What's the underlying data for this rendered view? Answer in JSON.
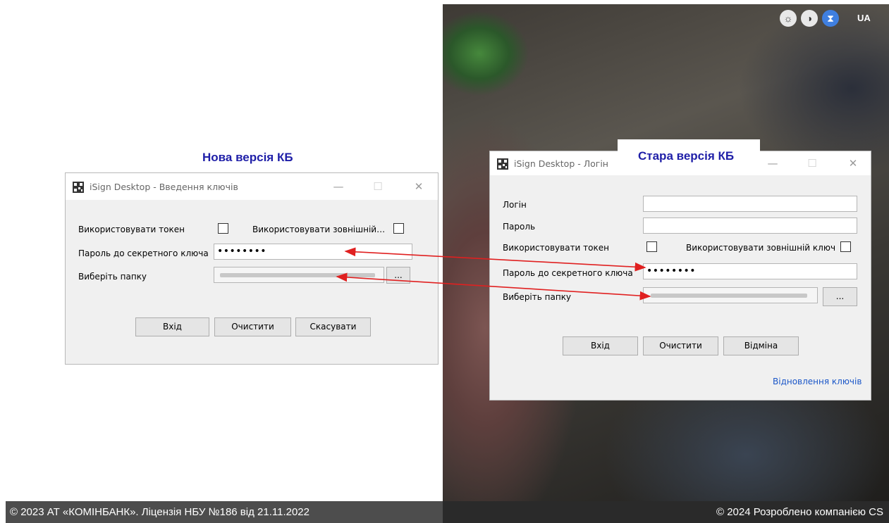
{
  "captions": {
    "new_version": "Нова версія КБ",
    "old_version": "Стара версія КБ"
  },
  "top_controls": {
    "icons": [
      "brightness-icon",
      "contrast-icon",
      "hourglass-icon"
    ],
    "language": "UA"
  },
  "new_dialog": {
    "title": "iSign Desktop - Введення ключів",
    "use_token_label": "Використовувати токен",
    "use_external_label": "Використовувати зовнішній…",
    "password_label": "Пароль до секретного ключа",
    "password_value": "••••••••",
    "folder_label": "Виберіть папку",
    "browse_label": "...",
    "buttons": {
      "login": "Вхід",
      "clear": "Очистити",
      "cancel": "Скасувати"
    }
  },
  "old_dialog": {
    "title": "iSign Desktop - Логін",
    "login_label": "Логін",
    "password_label": "Пароль",
    "use_token_label": "Використовувати токен",
    "use_external_label": "Використовувати зовнішній ключ",
    "secret_password_label": "Пароль до секретного ключа",
    "secret_password_value": "••••••••",
    "folder_label": "Виберіть папку",
    "browse_label": "...",
    "buttons": {
      "login": "Вхід",
      "clear": "Очистити",
      "cancel": "Відміна"
    },
    "restore_link": "Відновлення ключів"
  },
  "footer": {
    "left": "© 2023 АТ «КОМІНБАНК». Ліцензія НБУ №186 від 21.11.2022",
    "right": "© 2024 Розроблено компанією CS"
  },
  "colors": {
    "caption": "#1f1fa8",
    "arrow": "#e02020",
    "link": "#1a56c8"
  }
}
